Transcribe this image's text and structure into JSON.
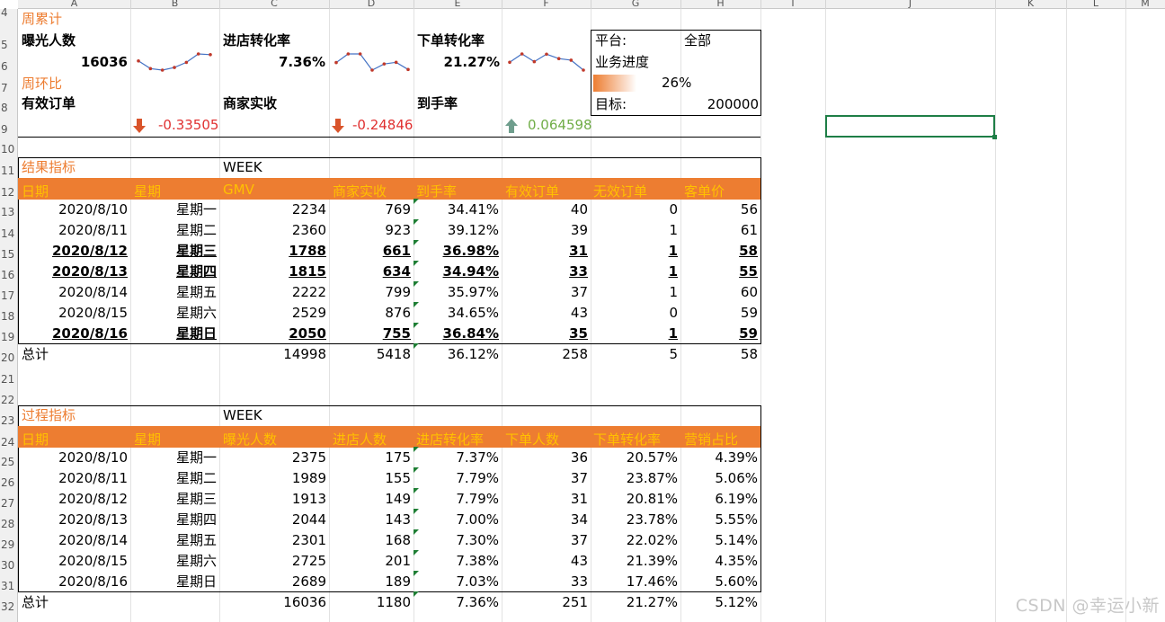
{
  "columns": [
    "A",
    "B",
    "C",
    "D",
    "E",
    "F",
    "G",
    "H",
    "I",
    "J",
    "K",
    "L",
    "M"
  ],
  "rows": [
    "4",
    "5",
    "6",
    "7",
    "8",
    "9",
    "10",
    "11",
    "12",
    "13",
    "14",
    "15",
    "16",
    "17",
    "18",
    "19",
    "20",
    "21",
    "22",
    "23",
    "24",
    "25",
    "26",
    "27",
    "28",
    "29",
    "30",
    "31",
    "32"
  ],
  "summary": {
    "weekly_cum_label": "周累计",
    "wow_label": "周环比",
    "exposure_label": "曝光人数",
    "exposure_value": "16036",
    "store_conv_label": "进店转化率",
    "store_conv_value": "7.36%",
    "order_conv_label": "下单转化率",
    "order_conv_value": "21.27%",
    "valid_orders_label": "有效订单",
    "valid_orders_change": "-0.33505",
    "merchant_revenue_label": "商家实收",
    "merchant_revenue_change": "-0.24846",
    "arrival_rate_label": "到手率",
    "arrival_rate_change": "0.064598"
  },
  "sparklines": {
    "exposure": [
      2375,
      1989,
      1913,
      2044,
      2301,
      2725,
      2689
    ],
    "store_conv": [
      7.37,
      7.79,
      7.79,
      7.0,
      7.3,
      7.38,
      7.03
    ],
    "order_conv": [
      20.57,
      23.87,
      20.81,
      23.78,
      22.02,
      21.39,
      17.46
    ]
  },
  "platform_box": {
    "platform_label": "平台:",
    "platform_value": "全部",
    "progress_label": "业务进度",
    "progress_value": "26%",
    "progress_fraction": 0.26,
    "target_label": "目标:",
    "target_value": "200000"
  },
  "result_table": {
    "title": "结果指标",
    "week_label": "WEEK",
    "headers": [
      "日期",
      "星期",
      "GMV",
      "商家实收",
      "到手率",
      "有效订单",
      "无效订单",
      "客单价"
    ],
    "rows": [
      {
        "cells": [
          "2020/8/10",
          "星期一",
          "2234",
          "769",
          "34.41%",
          "40",
          "0",
          "56"
        ],
        "bold": false
      },
      {
        "cells": [
          "2020/8/11",
          "星期二",
          "2360",
          "923",
          "39.12%",
          "39",
          "1",
          "61"
        ],
        "bold": false
      },
      {
        "cells": [
          "2020/8/12",
          "星期三",
          "1788",
          "661",
          "36.98%",
          "31",
          "1",
          "58"
        ],
        "bold": true
      },
      {
        "cells": [
          "2020/8/13",
          "星期四",
          "1815",
          "634",
          "34.94%",
          "33",
          "1",
          "55"
        ],
        "bold": true
      },
      {
        "cells": [
          "2020/8/14",
          "星期五",
          "2222",
          "799",
          "35.97%",
          "37",
          "1",
          "60"
        ],
        "bold": false
      },
      {
        "cells": [
          "2020/8/15",
          "星期六",
          "2529",
          "876",
          "34.65%",
          "43",
          "0",
          "59"
        ],
        "bold": false
      },
      {
        "cells": [
          "2020/8/16",
          "星期日",
          "2050",
          "755",
          "36.84%",
          "35",
          "1",
          "59"
        ],
        "bold": true
      }
    ],
    "total": [
      "总计",
      "",
      "14998",
      "5418",
      "36.12%",
      "258",
      "5",
      "58"
    ]
  },
  "process_table": {
    "title": "过程指标",
    "week_label": "WEEK",
    "headers": [
      "日期",
      "星期",
      "曝光人数",
      "进店人数",
      "进店转化率",
      "下单人数",
      "下单转化率",
      "营销占比"
    ],
    "rows": [
      {
        "cells": [
          "2020/8/10",
          "星期一",
          "2375",
          "175",
          "7.37%",
          "36",
          "20.57%",
          "4.39%"
        ]
      },
      {
        "cells": [
          "2020/8/11",
          "星期二",
          "1989",
          "155",
          "7.79%",
          "37",
          "23.87%",
          "5.06%"
        ]
      },
      {
        "cells": [
          "2020/8/12",
          "星期三",
          "1913",
          "149",
          "7.79%",
          "31",
          "20.81%",
          "6.19%"
        ]
      },
      {
        "cells": [
          "2020/8/13",
          "星期四",
          "2044",
          "143",
          "7.00%",
          "34",
          "23.78%",
          "5.55%"
        ]
      },
      {
        "cells": [
          "2020/8/14",
          "星期五",
          "2301",
          "168",
          "7.30%",
          "37",
          "22.02%",
          "5.14%"
        ]
      },
      {
        "cells": [
          "2020/8/15",
          "星期六",
          "2725",
          "201",
          "7.38%",
          "43",
          "21.39%",
          "4.35%"
        ]
      },
      {
        "cells": [
          "2020/8/16",
          "星期日",
          "2689",
          "189",
          "7.03%",
          "33",
          "17.46%",
          "5.60%"
        ]
      }
    ],
    "total": [
      "总计",
      "",
      "16036",
      "1180",
      "7.36%",
      "251",
      "21.27%",
      "5.12%"
    ]
  },
  "watermark": "CSDN @幸运小新",
  "colors": {
    "accent": "#ed7d31",
    "header_text": "#ffc000",
    "negative": "#e03030",
    "positive": "#70ad47",
    "selection": "#1e7e46"
  }
}
